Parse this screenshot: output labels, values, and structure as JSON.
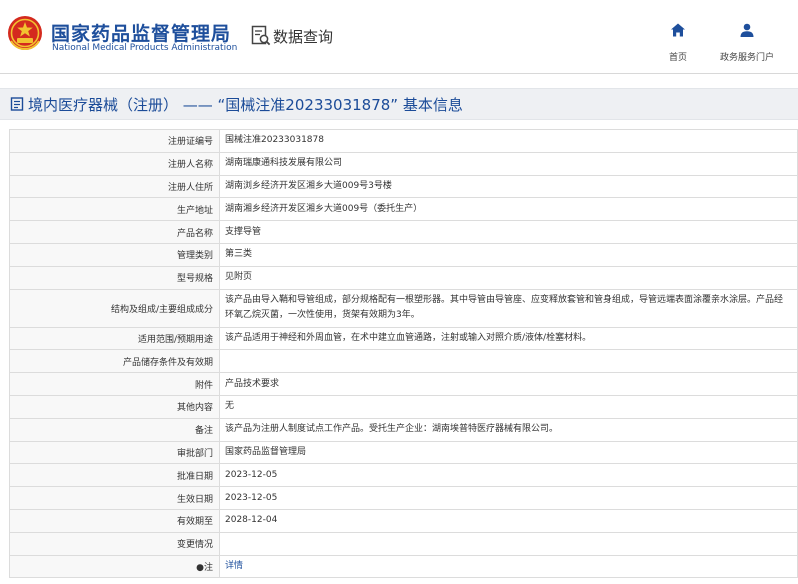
{
  "header": {
    "brand_cn": "国家药品监督管理局",
    "brand_en": "National Medical Products Administration",
    "query_label": "数据查询",
    "nav": [
      {
        "label": "首页",
        "icon": "home-icon"
      },
      {
        "label": "政务服务门户",
        "icon": "user-icon"
      }
    ]
  },
  "title": "境内医疗器械（注册） —— “国械注准20233031878” 基本信息",
  "rows": [
    {
      "key": "注册证编号",
      "value": "国械注准20233031878"
    },
    {
      "key": "注册人名称",
      "value": "湖南瑞康通科技发展有限公司"
    },
    {
      "key": "注册人住所",
      "value": "湖南浏乡经济开发区湘乡大道009号3号楼"
    },
    {
      "key": "生产地址",
      "value": "湖南湘乡经济开发区湘乡大道009号（委托生产）"
    },
    {
      "key": "产品名称",
      "value": "支撑导管"
    },
    {
      "key": "管理类别",
      "value": "第三类"
    },
    {
      "key": "型号规格",
      "value": "见附页"
    },
    {
      "key": "结构及组成/主要组成成分",
      "value": "该产品由导入鞘和导管组成，部分规格配有一根塑形器。其中导管由导管座、应变释放套管和管身组成，导管远端表面涂覆亲水涂层。产品经环氧乙烷灭菌，一次性使用，货架有效期为3年。"
    },
    {
      "key": "适用范围/预期用途",
      "value": "该产品适用于神经和外周血管，在术中建立血管通路，注射或输入对照介质/液体/栓塞材料。"
    },
    {
      "key": "产品储存条件及有效期",
      "value": ""
    },
    {
      "key": "附件",
      "value": "产品技术要求"
    },
    {
      "key": "其他内容",
      "value": "无"
    },
    {
      "key": "备注",
      "value": "该产品为注册人制度试点工作产品。受托生产企业：湖南埃普特医疗器械有限公司。"
    },
    {
      "key": "审批部门",
      "value": "国家药品监督管理局"
    },
    {
      "key": "批准日期",
      "value": "2023-12-05"
    },
    {
      "key": "生效日期",
      "value": "2023-12-05"
    },
    {
      "key": "有效期至",
      "value": "2028-12-04"
    },
    {
      "key": "变更情况",
      "value": ""
    },
    {
      "key": "●注",
      "value": "详情"
    }
  ],
  "colors": {
    "brand_blue": "#1e4f9c",
    "emblem_red": "#d42a1e",
    "emblem_gold": "#f2c230",
    "link_blue": "#1e4f9c"
  }
}
